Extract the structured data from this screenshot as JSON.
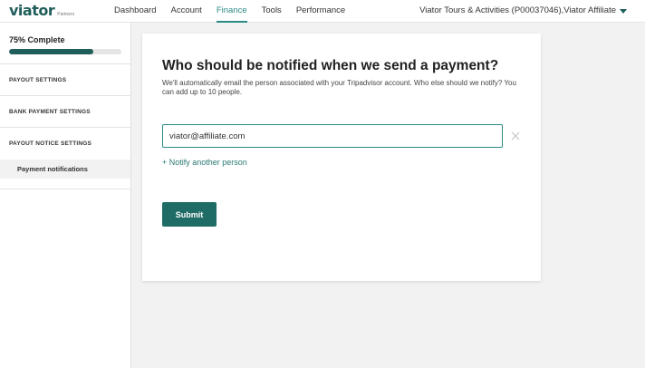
{
  "brand": {
    "logo_text": "viator",
    "logo_sub": "Partners"
  },
  "nav": {
    "tabs": [
      {
        "label": "Dashboard"
      },
      {
        "label": "Account"
      },
      {
        "label": "Finance"
      },
      {
        "label": "Tools"
      },
      {
        "label": "Performance"
      }
    ],
    "active_tab": "Finance",
    "account_label": "Viator Tours & Activities (P00037046),Viator Affiliate"
  },
  "sidebar": {
    "progress_label": "75% Complete",
    "progress_value": 0.75,
    "sections": [
      {
        "label": "PAYOUT SETTINGS"
      },
      {
        "label": "BANK PAYMENT SETTINGS"
      },
      {
        "label": "PAYOUT NOTICE SETTINGS",
        "subitems": [
          {
            "label": "Payment notifications"
          }
        ]
      }
    ]
  },
  "main": {
    "title": "Who should be notified when we send a payment?",
    "description": "We'll automatically email the person associated with your Tripadvisor account. Who else should we notify? You can add up to 10 people.",
    "email_value": "viator@affiliate.com",
    "notify_link": "+ Notify another person",
    "submit_label": "Submit"
  },
  "colors": {
    "brand": "#1f5e5a",
    "accent": "#2a8a84",
    "button": "#1f6b65"
  }
}
